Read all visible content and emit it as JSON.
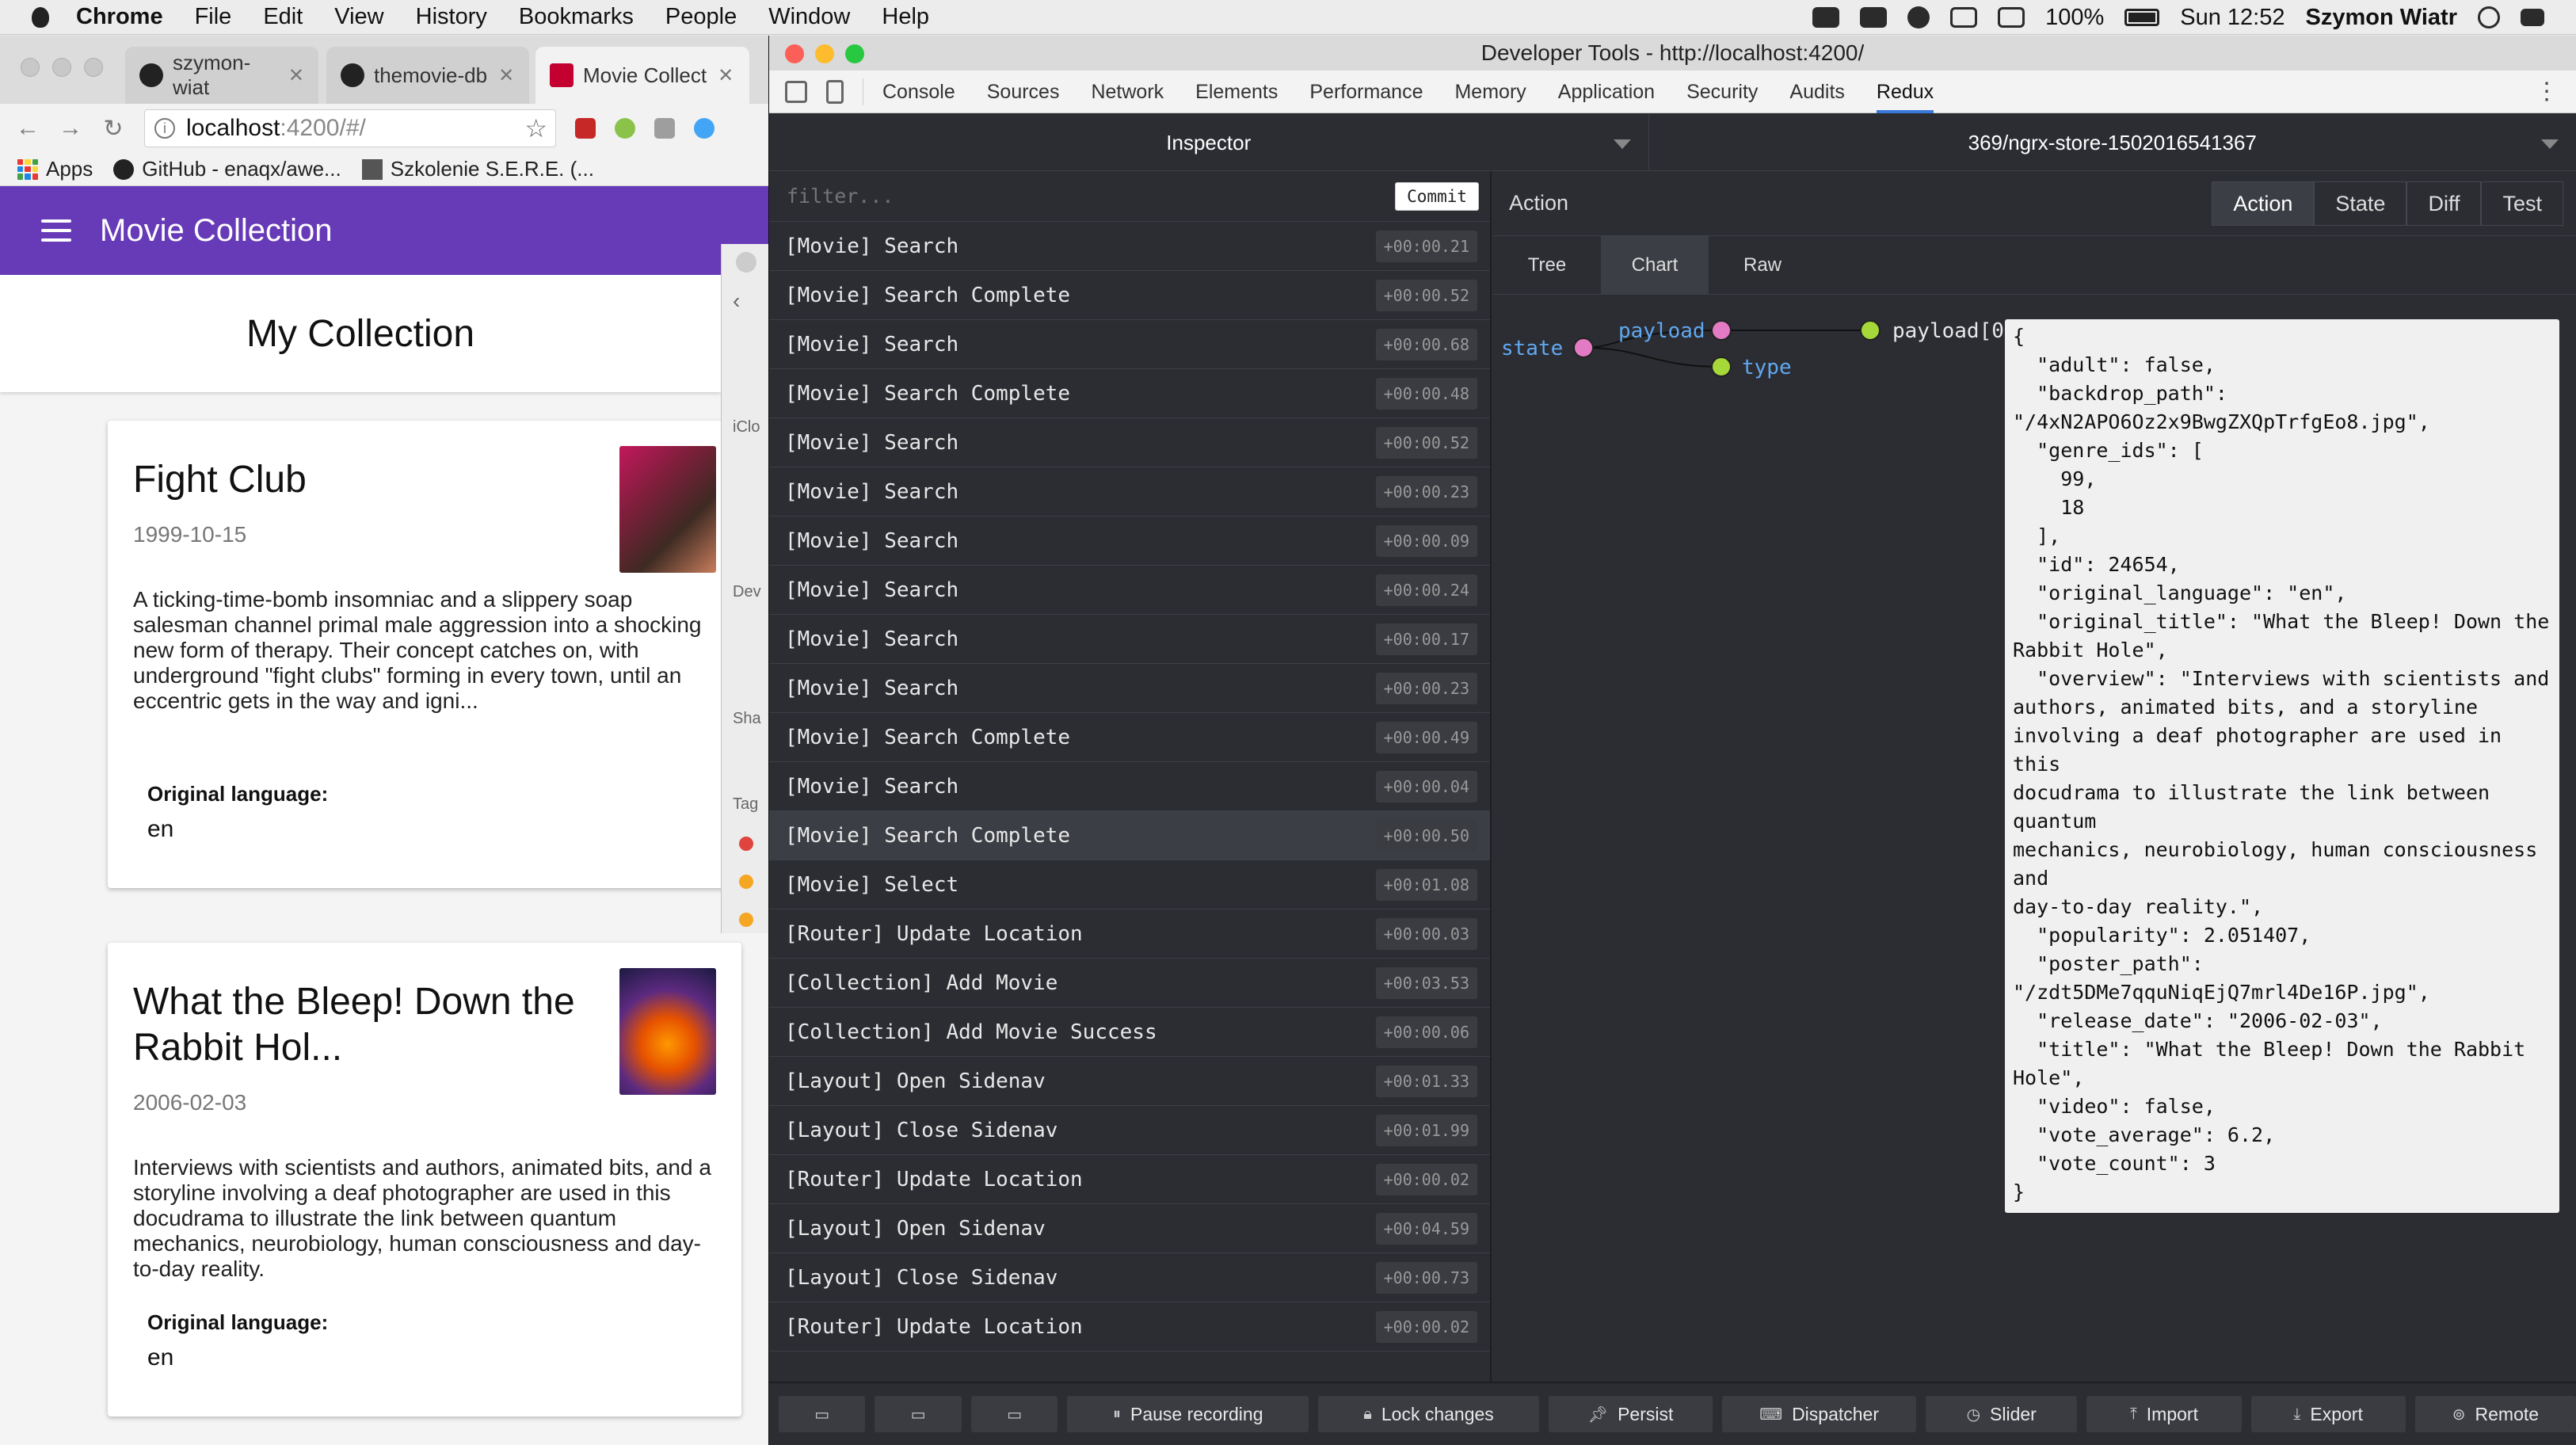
{
  "menubar": {
    "app_name": "Chrome",
    "items": [
      "File",
      "Edit",
      "View",
      "History",
      "Bookmarks",
      "People",
      "Window",
      "Help"
    ],
    "battery": "100%",
    "clock": "Sun 12:52",
    "user": "Szymon Wiatr"
  },
  "chrome": {
    "tabs": [
      {
        "label": "szymon-wiat",
        "icon": "github-icon"
      },
      {
        "label": "themovie-db",
        "icon": "github-icon"
      },
      {
        "label": "Movie Collect",
        "icon": "angular-icon"
      }
    ],
    "url_host": "localhost",
    "url_rest": ":4200/#/",
    "bookmarks": [
      {
        "label": "Apps",
        "icon": "apps-grid-icon"
      },
      {
        "label": "GitHub - enaqx/awe...",
        "icon": "github-icon"
      },
      {
        "label": "Szkolenie S.E.R.E. (...",
        "icon": "bookmark-image-icon"
      }
    ]
  },
  "app": {
    "title": "Movie Collection",
    "heading": "My Collection",
    "movies": [
      {
        "title": "Fight Club",
        "date": "1999-10-15",
        "overview": "A ticking-time-bomb insomniac and a slippery soap salesman channel primal male aggression into a shocking new form of therapy. Their concept catches on, with underground \"fight clubs\" forming in every town, until an eccentric gets in the way and igni...",
        "lang_label": "Original language:",
        "lang": "en"
      },
      {
        "title": "What the Bleep! Down the Rabbit Hol...",
        "date": "2006-02-03",
        "overview": "Interviews with scientists and authors, animated bits, and a storyline involving a deaf photographer are used in this docudrama to illustrate the link between quantum mechanics, neurobiology, human consciousness and day-to-day reality.",
        "lang_label": "Original language:",
        "lang": "en"
      }
    ]
  },
  "finder": {
    "labels": [
      "iClo",
      "Dev",
      "Sha",
      "Tag"
    ],
    "tag_colors": [
      "#e0443e",
      "#f5a623",
      "#f5a623"
    ]
  },
  "devtools": {
    "title": "Developer Tools - http://localhost:4200/",
    "tabs": [
      "Console",
      "Sources",
      "Network",
      "Elements",
      "Performance",
      "Memory",
      "Application",
      "Security",
      "Audits",
      "Redux"
    ],
    "active_tab": "Redux"
  },
  "redux": {
    "monitor": "Inspector",
    "instance": "369/ngrx-store-1502016541367",
    "filter_placeholder": "filter...",
    "commit_label": "Commit",
    "actions": [
      {
        "name": "[Movie] Search",
        "time": "+00:00.21"
      },
      {
        "name": "[Movie] Search Complete",
        "time": "+00:00.52"
      },
      {
        "name": "[Movie] Search",
        "time": "+00:00.68"
      },
      {
        "name": "[Movie] Search Complete",
        "time": "+00:00.48"
      },
      {
        "name": "[Movie] Search",
        "time": "+00:00.52"
      },
      {
        "name": "[Movie] Search",
        "time": "+00:00.23"
      },
      {
        "name": "[Movie] Search",
        "time": "+00:00.09"
      },
      {
        "name": "[Movie] Search",
        "time": "+00:00.24"
      },
      {
        "name": "[Movie] Search",
        "time": "+00:00.17"
      },
      {
        "name": "[Movie] Search",
        "time": "+00:00.23"
      },
      {
        "name": "[Movie] Search Complete",
        "time": "+00:00.49"
      },
      {
        "name": "[Movie] Search",
        "time": "+00:00.04"
      },
      {
        "name": "[Movie] Search Complete",
        "time": "+00:00.50",
        "selected": true
      },
      {
        "name": "[Movie] Select",
        "time": "+00:01.08"
      },
      {
        "name": "[Router] Update Location",
        "time": "+00:00.03"
      },
      {
        "name": "[Collection] Add Movie",
        "time": "+00:03.53"
      },
      {
        "name": "[Collection] Add Movie Success",
        "time": "+00:00.06"
      },
      {
        "name": "[Layout] Open Sidenav",
        "time": "+00:01.33"
      },
      {
        "name": "[Layout] Close Sidenav",
        "time": "+00:01.99"
      },
      {
        "name": "[Router] Update Location",
        "time": "+00:00.02"
      },
      {
        "name": "[Layout] Open Sidenav",
        "time": "+00:04.59"
      },
      {
        "name": "[Layout] Close Sidenav",
        "time": "+00:00.73"
      },
      {
        "name": "[Router] Update Location",
        "time": "+00:00.02"
      }
    ],
    "action_title": "Action",
    "mode_tabs": [
      "Action",
      "State",
      "Diff",
      "Test"
    ],
    "active_mode": "Action",
    "view_tabs": [
      "Tree",
      "Chart",
      "Raw"
    ],
    "active_view": "Chart",
    "chart": {
      "root": "state",
      "children": [
        "payload",
        "type"
      ],
      "grandchild": "payload[0]"
    },
    "tooltip_json": "{\n  \"adult\": false,\n  \"backdrop_path\":\n\"/4xN2APO6Oz2x9BwgZXQpTrfgEo8.jpg\",\n  \"genre_ids\": [\n    99,\n    18\n  ],\n  \"id\": 24654,\n  \"original_language\": \"en\",\n  \"original_title\": \"What the Bleep! Down the\nRabbit Hole\",\n  \"overview\": \"Interviews with scientists and\nauthors, animated bits, and a storyline\ninvolving a deaf photographer are used in this\ndocudrama to illustrate the link between quantum\nmechanics, neurobiology, human consciousness and\nday-to-day reality.\",\n  \"popularity\": 2.051407,\n  \"poster_path\":\n\"/zdt5DMe7qquNiqEjQ7mrl4De16P.jpg\",\n  \"release_date\": \"2006-02-03\",\n  \"title\": \"What the Bleep! Down the Rabbit\nHole\",\n  \"video\": false,\n  \"vote_average\": 6.2,\n  \"vote_count\": 3\n}",
    "footer": [
      {
        "label": "Pause recording",
        "icon": "pause-icon"
      },
      {
        "label": "Lock changes",
        "icon": "lock-icon"
      },
      {
        "label": "Persist",
        "icon": "pin-icon"
      },
      {
        "label": "Dispatcher",
        "icon": "keyboard-icon"
      },
      {
        "label": "Slider",
        "icon": "clock-icon"
      },
      {
        "label": "Import",
        "icon": "upload-icon"
      },
      {
        "label": "Export",
        "icon": "download-icon"
      },
      {
        "label": "Remote",
        "icon": "broadcast-icon"
      }
    ],
    "colors": {
      "node_pink": "#e27ac4",
      "node_green": "#a6d83a",
      "link_label": "#61a8f0"
    }
  }
}
